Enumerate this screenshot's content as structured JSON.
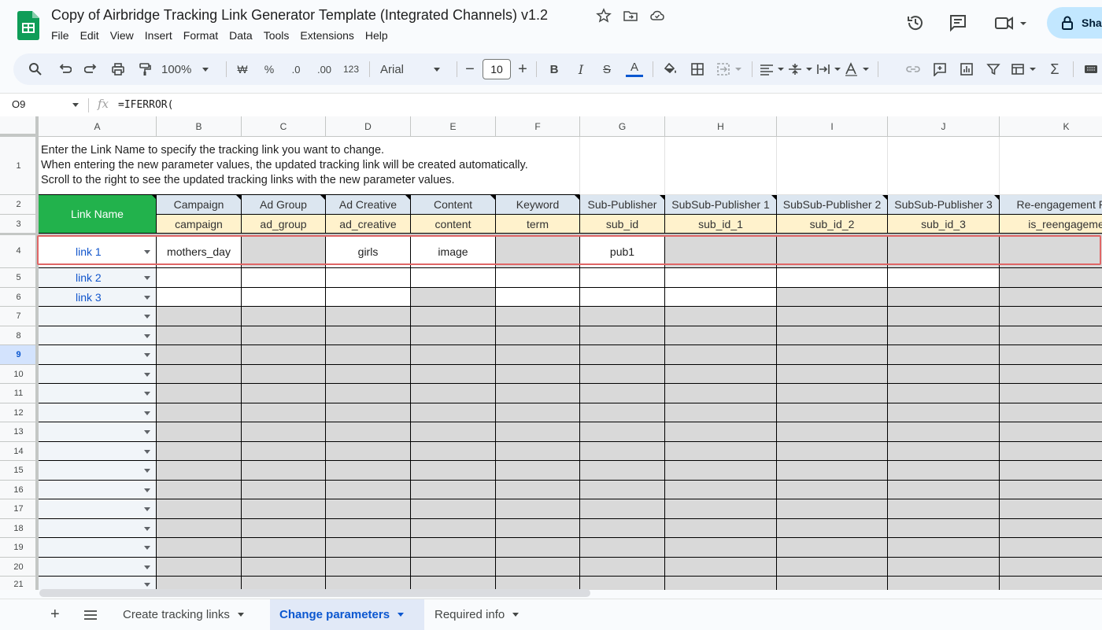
{
  "app": {
    "title": "Copy of Airbridge Tracking Link Generator Template (Integrated Channels) v1.2",
    "share_label": "Sha",
    "accent_color": "#0b57d0"
  },
  "menu": [
    "File",
    "Edit",
    "View",
    "Insert",
    "Format",
    "Data",
    "Tools",
    "Extensions",
    "Help"
  ],
  "toolbar": {
    "zoom": "100%",
    "currency": "₩",
    "percent": "%",
    "dec_decrease": ".0",
    "dec_increase": ".00",
    "number_format": "123",
    "font": "Arial",
    "font_size": "10"
  },
  "formula_bar": {
    "cell_ref": "O9",
    "fx": "fx",
    "formula": "=IFERROR("
  },
  "columns": [
    "A",
    "B",
    "C",
    "D",
    "E",
    "F",
    "G",
    "H",
    "I",
    "J",
    "K"
  ],
  "rows": [
    "1",
    "2",
    "3",
    "4",
    "5",
    "6",
    "7",
    "8",
    "9",
    "10",
    "11",
    "12",
    "13",
    "14",
    "15",
    "16",
    "17",
    "18",
    "19",
    "20",
    "21"
  ],
  "selected_row": "9",
  "instructions": [
    "Enter the Link Name to specify the tracking link you want to change.",
    "When entering the new parameter values, the updated tracking link will be created automatically.",
    "Scroll to the right to see the updated tracking links with the new parameter values."
  ],
  "link_name_header": "Link Name",
  "param_headers": [
    "Campaign",
    "Ad Group",
    "Ad Creative",
    "Content",
    "Keyword",
    "Sub-Publisher",
    "SubSub-Publisher 1",
    "SubSub-Publisher 2",
    "SubSub-Publisher 3",
    "Re-engagement Par"
  ],
  "param_keys": [
    "campaign",
    "ad_group",
    "ad_creative",
    "content",
    "term",
    "sub_id",
    "sub_id_1",
    "sub_id_2",
    "sub_id_3",
    "is_reengageme"
  ],
  "link_rows": [
    {
      "name": "link 1",
      "values": [
        "mothers_day",
        "",
        "girls",
        "image",
        "",
        "pub1",
        "",
        "",
        "",
        ""
      ]
    },
    {
      "name": "link 2",
      "values": [
        "",
        "",
        "",
        "",
        "",
        "",
        "",
        "",
        "",
        ""
      ]
    },
    {
      "name": "link 3",
      "values": [
        "",
        "",
        "",
        "",
        "",
        "",
        "",
        "",
        "",
        ""
      ]
    }
  ],
  "sheets": [
    {
      "label": "Create tracking links",
      "active": false
    },
    {
      "label": "Change parameters",
      "active": true
    },
    {
      "label": "Required info",
      "active": false
    }
  ]
}
